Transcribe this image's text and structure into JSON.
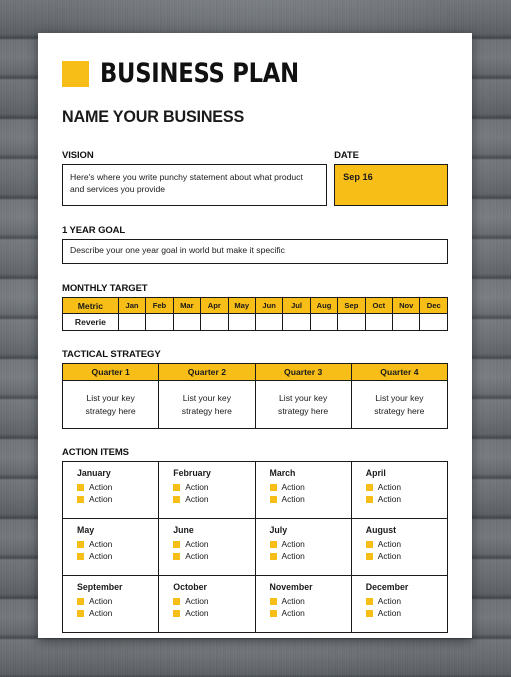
{
  "theme": {
    "accent": "#F7BE17",
    "ink": "#1a1a1a",
    "paper": "#ffffff"
  },
  "header": {
    "title": "BUSINESS PLAN",
    "business_name": "NAME YOUR BUSINESS",
    "logo_icon": "yellow-square-icon"
  },
  "vision": {
    "label": "VISION",
    "text": "Here's where you write punchy statement about what product and services you provide"
  },
  "date": {
    "label": "DATE",
    "value": "Sep 16"
  },
  "goal": {
    "label": "1 YEAR GOAL",
    "text": "Describe your one year goal in world but make it specific"
  },
  "monthly_target": {
    "label": "MONTHLY TARGET",
    "columns": [
      "Metric",
      "Jan",
      "Feb",
      "Mar",
      "Apr",
      "May",
      "Jun",
      "Jul",
      "Aug",
      "Sep",
      "Oct",
      "Nov",
      "Dec"
    ],
    "rows": [
      {
        "metric": "Reverie",
        "values": [
          "",
          "",
          "",
          "",
          "",
          "",
          "",
          "",
          "",
          "",
          "",
          ""
        ]
      }
    ]
  },
  "tactical_strategy": {
    "label": "TACTICAL STRATEGY",
    "columns": [
      "Quarter 1",
      "Quarter 2",
      "Quarter 3",
      "Quarter 4"
    ],
    "values": [
      "List your key strategy here",
      "List your key strategy here",
      "List your key strategy here",
      "List your key strategy here"
    ]
  },
  "action_items": {
    "label": "ACTION ITEMS",
    "cells": [
      {
        "month": "January",
        "items": [
          "Action",
          "Action"
        ]
      },
      {
        "month": "February",
        "items": [
          "Action",
          "Action"
        ]
      },
      {
        "month": "March",
        "items": [
          "Action",
          "Action"
        ]
      },
      {
        "month": "April",
        "items": [
          "Action",
          "Action"
        ]
      },
      {
        "month": "May",
        "items": [
          "Action",
          "Action"
        ]
      },
      {
        "month": "June",
        "items": [
          "Action",
          "Action"
        ]
      },
      {
        "month": "July",
        "items": [
          "Action",
          "Action"
        ]
      },
      {
        "month": "August",
        "items": [
          "Action",
          "Action"
        ]
      },
      {
        "month": "September",
        "items": [
          "Action",
          "Action"
        ]
      },
      {
        "month": "October",
        "items": [
          "Action",
          "Action"
        ]
      },
      {
        "month": "November",
        "items": [
          "Action",
          "Action"
        ]
      },
      {
        "month": "December",
        "items": [
          "Action",
          "Action"
        ]
      }
    ]
  }
}
